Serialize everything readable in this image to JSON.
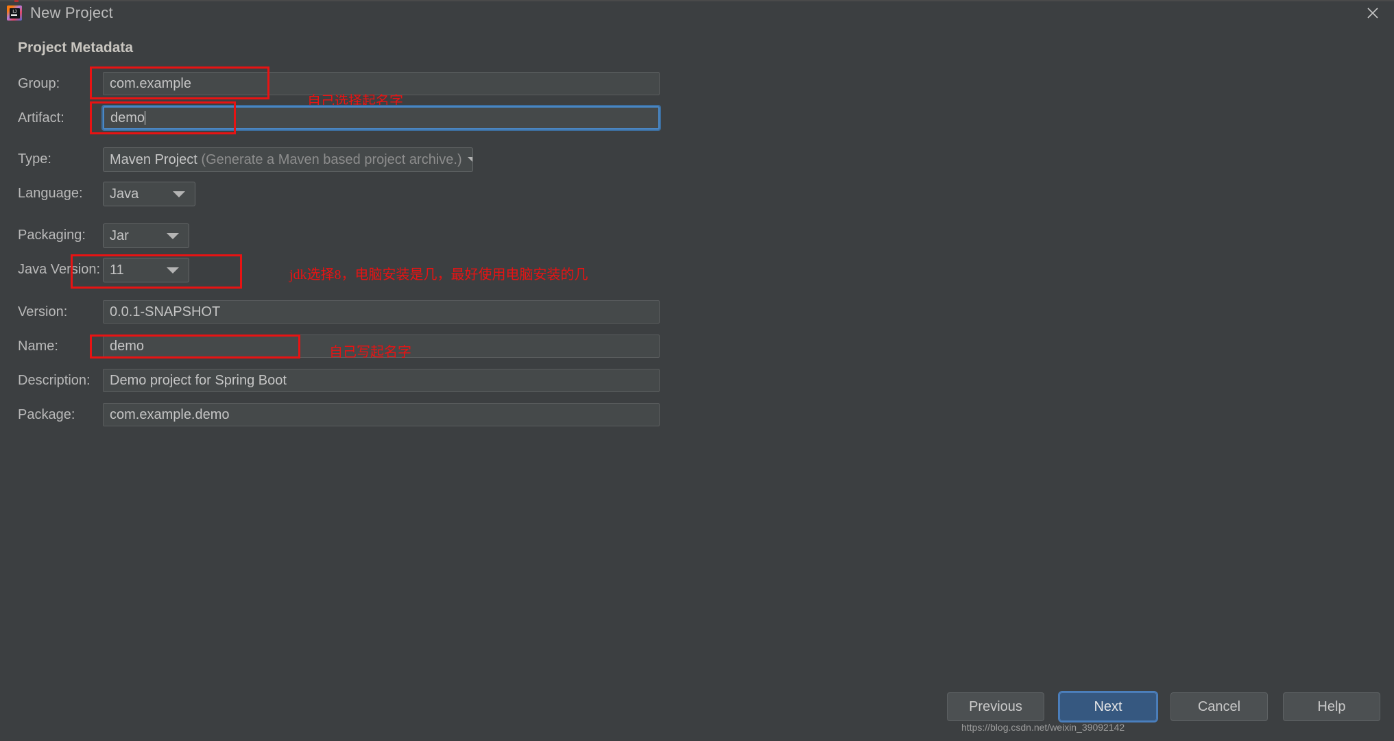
{
  "window": {
    "title": "New Project",
    "logo_icon": "intellij-idea-logo",
    "close_icon": "close-icon"
  },
  "section": {
    "title": "Project Metadata"
  },
  "form": {
    "group": {
      "label": "Group:",
      "value": "com.example"
    },
    "artifact": {
      "label": "Artifact:",
      "value": "demo"
    },
    "type": {
      "label": "Type:",
      "value": "Maven Project",
      "hint": "(Generate a Maven based project archive.)",
      "arrow_icon": "chevron-down-icon"
    },
    "language": {
      "label": "Language:",
      "value": "Java",
      "arrow_icon": "chevron-down-icon"
    },
    "packaging": {
      "label": "Packaging:",
      "value": "Jar",
      "arrow_icon": "chevron-down-icon"
    },
    "java_version": {
      "label": "Java Version:",
      "value": "11",
      "arrow_icon": "chevron-down-icon"
    },
    "version": {
      "label": "Version:",
      "value": "0.0.1-SNAPSHOT"
    },
    "name": {
      "label": "Name:",
      "value": "demo"
    },
    "description": {
      "label": "Description:",
      "value": "Demo project for Spring Boot"
    },
    "package": {
      "label": "Package:",
      "value": "com.example.demo"
    }
  },
  "annotations": {
    "color": "#e81313",
    "group_note": "自己选择起名字",
    "java_version_note": "jdk选择8，电脑安装是几，最好使用电脑安装的几",
    "name_note": "自己写起名字"
  },
  "footer": {
    "previous_label": "Previous",
    "next_label": "Next",
    "cancel_label": "Cancel",
    "help_label": "Help",
    "accent_color": "#365880"
  },
  "watermark": {
    "text": "https://blog.csdn.net/weixin_39092142"
  }
}
